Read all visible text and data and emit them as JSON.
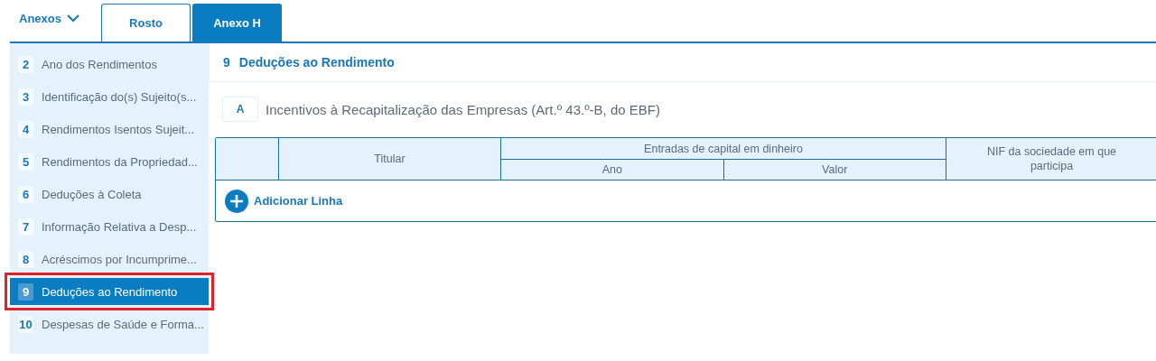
{
  "annexes_menu": {
    "label": "Anexos"
  },
  "tabs": [
    {
      "label": "Rosto",
      "selected": false
    },
    {
      "label": "Anexo H",
      "selected": true
    }
  ],
  "sidebar": {
    "items": [
      {
        "number": "2",
        "label": "Ano dos Rendimentos",
        "selected": false,
        "highlighted": false
      },
      {
        "number": "3",
        "label": "Identificação do(s) Sujeito(s...",
        "selected": false,
        "highlighted": false
      },
      {
        "number": "4",
        "label": "Rendimentos Isentos Sujeit...",
        "selected": false,
        "highlighted": false
      },
      {
        "number": "5",
        "label": "Rendimentos da Propriedad...",
        "selected": false,
        "highlighted": false
      },
      {
        "number": "6",
        "label": "Deduções à Coleta",
        "selected": false,
        "highlighted": false
      },
      {
        "number": "7",
        "label": "Informação Relativa a Desp...",
        "selected": false,
        "highlighted": false
      },
      {
        "number": "8",
        "label": "Acréscimos por Incumprime...",
        "selected": false,
        "highlighted": false
      },
      {
        "number": "9",
        "label": "Deduções ao Rendimento",
        "selected": true,
        "highlighted": true
      },
      {
        "number": "10",
        "label": "Despesas de Saúde e Forma...",
        "selected": false,
        "highlighted": false
      }
    ]
  },
  "section": {
    "number": "9",
    "title": "Deduções ao Rendimento"
  },
  "subsection": {
    "letter": "A",
    "title": "Incentivos à Recapitalização das Empresas (Art.º 43.º-B, do EBF)"
  },
  "table": {
    "columns": {
      "titular": "Titular",
      "group": "Entradas de capital em dinheiro",
      "year": "Ano",
      "value": "Valor",
      "nif": "NIF da sociedade em que participa"
    },
    "add_row": "Adicionar Linha"
  }
}
